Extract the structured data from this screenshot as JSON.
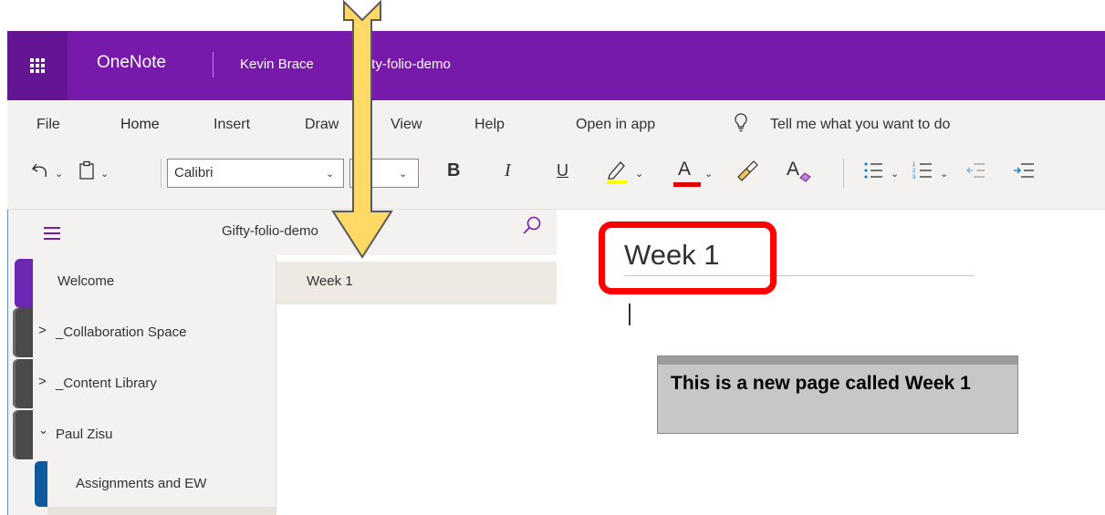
{
  "header": {
    "app_name": "OneNote",
    "user_name": "Kevin Brace",
    "notebook_breadcrumb": "Gifty-folio-demo"
  },
  "menu": [
    "File",
    "Home",
    "Insert",
    "Draw",
    "View",
    "Help",
    "Open in app"
  ],
  "tell_me": "Tell me what you want to do",
  "toolbar": {
    "font_name": "Calibri",
    "bold": "B",
    "italic": "I",
    "underline": "U",
    "font_color_letter": "A",
    "clear_format_letter": "A"
  },
  "notebook": {
    "name": "Gifty-folio-demo"
  },
  "sections": [
    {
      "label": "Welcome",
      "expand": ""
    },
    {
      "label": "_Collaboration Space",
      "expand": ">"
    },
    {
      "label": "_Content Library",
      "expand": ">"
    },
    {
      "label": "Paul Zisu",
      "expand": "v"
    },
    {
      "label": "Assignments and EW",
      "expand": ""
    }
  ],
  "pages": [
    {
      "label": "Week 1"
    }
  ],
  "page": {
    "title": "Week 1",
    "note_text": "This is a new page called Week 1"
  },
  "colors": {
    "brand": "#7719aa",
    "highlight": "#ff0000",
    "arrow_fill": "#ffd966"
  }
}
